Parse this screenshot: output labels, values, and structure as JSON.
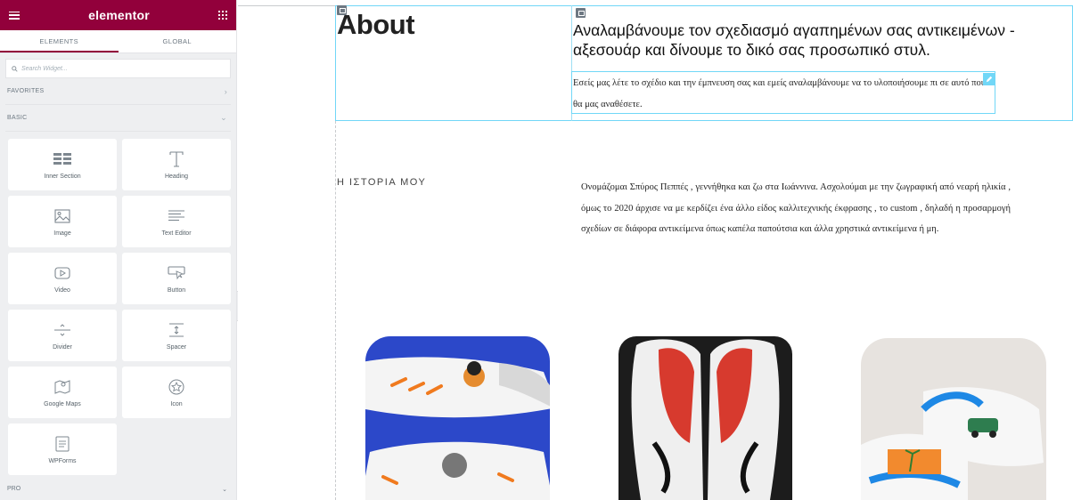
{
  "sidebar": {
    "brand": "elementor",
    "tabs": [
      {
        "label": "ELEMENTS",
        "active": true
      },
      {
        "label": "GLOBAL",
        "active": false
      }
    ],
    "search": {
      "placeholder": "Search Widget..."
    },
    "categories": {
      "favorites": "FAVORITES",
      "basic": "BASIC",
      "pro": "PRO"
    },
    "widgets": [
      {
        "label": "Inner Section",
        "icon": "inner-section-icon"
      },
      {
        "label": "Heading",
        "icon": "heading-icon"
      },
      {
        "label": "Image",
        "icon": "image-icon"
      },
      {
        "label": "Text Editor",
        "icon": "text-editor-icon"
      },
      {
        "label": "Video",
        "icon": "video-icon"
      },
      {
        "label": "Button",
        "icon": "button-icon"
      },
      {
        "label": "Divider",
        "icon": "divider-icon"
      },
      {
        "label": "Spacer",
        "icon": "spacer-icon"
      },
      {
        "label": "Google Maps",
        "icon": "map-icon"
      },
      {
        "label": "Icon",
        "icon": "star-icon"
      },
      {
        "label": "WPForms",
        "icon": "form-icon"
      }
    ],
    "accent_color": "#92003b"
  },
  "canvas": {
    "heading": "About",
    "headline": "Αναλαμβάνουμε τον σχεδιασμό αγαπημένων σας αντικειμένων - αξεσουάρ και δίνουμε το δικό σας προσωπικό στυλ.",
    "intro": "Εσείς μας λέτε το σχέδιο και την έμπνευση σας και εμείς αναλαμβάνουμε να το υλοποιήσουμε πι σε αυτό που θα μας αναθέσετε.",
    "story_title": "Η ΙΣΤΟΡΙΑ ΜΟΥ",
    "story": "Ονομάζομαι Σπύρος Πεππές , γεννήθηκα και ζω στα Ιωάννινα. Ασχολούμαι με την ζωγραφική από νεαρή ηλικία , όμως το 2020 άρχισε να με κερδίζει ένα άλλο είδος καλλιτεχνικής έκφρασης , το custom , δηλαδή η προσαρμογή σχεδίων σε διάφορα αντικείμενα όπως καπέλα παπούτσια και άλλα χρηστικά αντικείμενα ή μη.",
    "selection_color": "#71d7f7"
  }
}
